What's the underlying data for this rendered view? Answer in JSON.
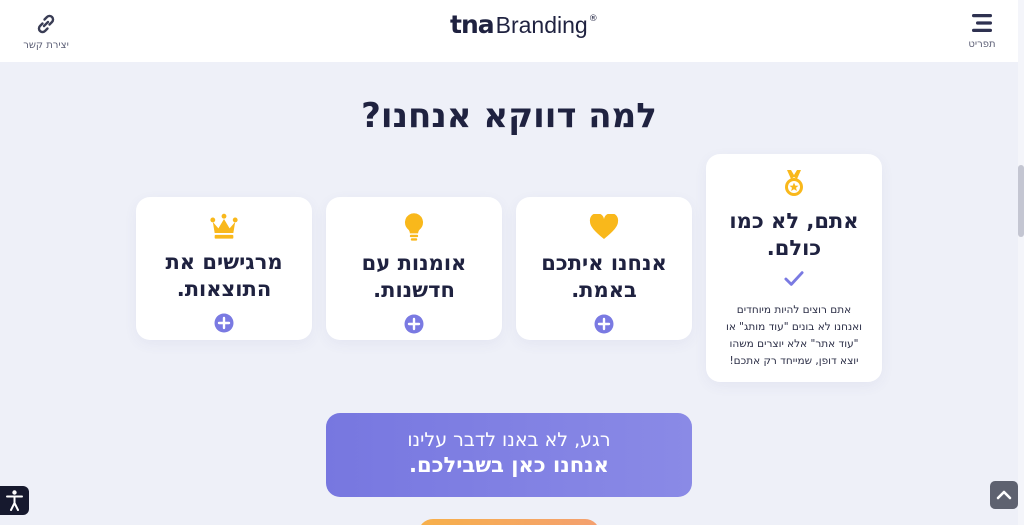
{
  "header": {
    "logo_bold": "tna",
    "logo_light": "Branding",
    "logo_mark": "®",
    "contact_label": "יצירת קשר",
    "contact_icon": "link-icon",
    "menu_label": "תפריט",
    "menu_icon": "hamburger-icon"
  },
  "main": {
    "title": "למה דווקא אנחנו?",
    "cards": [
      {
        "icon": "medal-icon",
        "title_line1": "אתם, לא כמו",
        "title_line2": "כולם.",
        "check_icon": "checkmark-icon",
        "desc_line1": "אתם רוצים להיות מיוחדים",
        "desc_line2": "ואנחנו לא בונים \"עוד מותג\" או",
        "desc_line3": "\"עוד אתר\" אלא יוצרים משהו",
        "desc_line4": "יוצא דופן, שמייחד רק אתכם!"
      },
      {
        "icon": "heart-icon",
        "title_line1": "אנחנו איתכם",
        "title_line2": "באמת.",
        "expand_icon": "plus-circle-icon"
      },
      {
        "icon": "lightbulb-icon",
        "title_line1": "אומנות עם",
        "title_line2": "חדשנות.",
        "expand_icon": "plus-circle-icon"
      },
      {
        "icon": "crown-icon",
        "title_line1": "מרגישים את",
        "title_line2": "התוצאות.",
        "expand_icon": "plus-circle-icon"
      }
    ],
    "cta": {
      "line1": "רגע, לא באנו לדבר עלינו",
      "line2": "אנחנו כאן בשבילכם."
    }
  },
  "widgets": {
    "accessibility_icon": "accessibility-icon",
    "scroll_top_icon": "chevron-up-icon"
  },
  "colors": {
    "accent_purple": "#7a7ae2",
    "icon_yellow": "#f9b81b",
    "text_dark": "#1f2240",
    "background": "#eef0f8"
  }
}
